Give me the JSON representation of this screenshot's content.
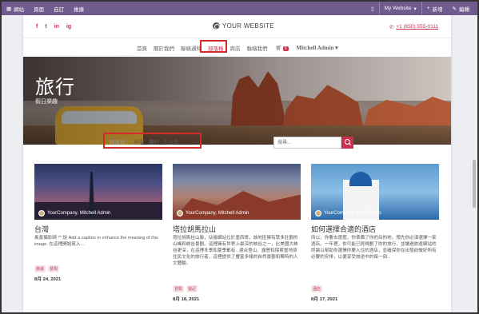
{
  "adminbar": {
    "left_items": [
      "網站",
      "頁面",
      "自訂",
      "推廣"
    ],
    "right_items": [
      "My Website",
      "新增",
      "編輯"
    ]
  },
  "header": {
    "social": [
      "f",
      "t",
      "in",
      "ig"
    ],
    "logo_text": "YOUR WEBSITE",
    "phone": "+1 (650) 555-0111"
  },
  "nav": {
    "items": [
      "首頁",
      "關於我們",
      "聯絡通知",
      "部落格",
      "商店",
      "聯絡我們"
    ],
    "cart_count": "0",
    "user": "Mitchell Admin"
  },
  "hero": {
    "title": "旅行",
    "subtitle": "假日樂趣"
  },
  "filter": {
    "label": "部落格：",
    "options": [
      "所有",
      "旅行",
      "天文學"
    ]
  },
  "search": {
    "placeholder": "搜尋..."
  },
  "cards": [
    {
      "title": "台灣",
      "author": "YourCompany, Mitchell Admin",
      "text": "風景攝影師 ** 說 Add a caption to enhance the meaning of this image. 在這裡開始寫入...",
      "tags": [
        "旅遊",
        "發現"
      ],
      "date": "8月 24, 2021"
    },
    {
      "title": "塔拉胡馬拉山",
      "author": "YourCompany, Mitchell Admin",
      "text": "塔拉胡馬拉山脈，佔據網站位於墨西哥，該地區擁有眾多壯觀的山峰和峽谷景觀。這裡擁有世界上最深的峽谷之一，比美國大峽谷更深，在這裡冬季和夏季都有...適合登山、露營和探索當地原住民文化的旅行者，這裡提供了豐富多樣的自然景觀和獨特的人文體驗。",
      "tags": [
        "冒險",
        "遊記"
      ],
      "date": "8月 18, 2021"
    },
    {
      "title": "如何選擇合適的酒店",
      "author": "YourCompany, Marc Demo",
      "text": "所以，你要去度假，你準備了你的目的地，預先你必須選擇一家酒店。一年裡，你可能已經規劃了你的旅行，並讀過旅遊網站的評論以幫助你選擇你要入住的酒店，並確保你在出發前做好所有必要的安排，以便享受旅途中的每一刻...",
      "tags": [
        "酒店"
      ],
      "date": "8月 17, 2021"
    }
  ]
}
